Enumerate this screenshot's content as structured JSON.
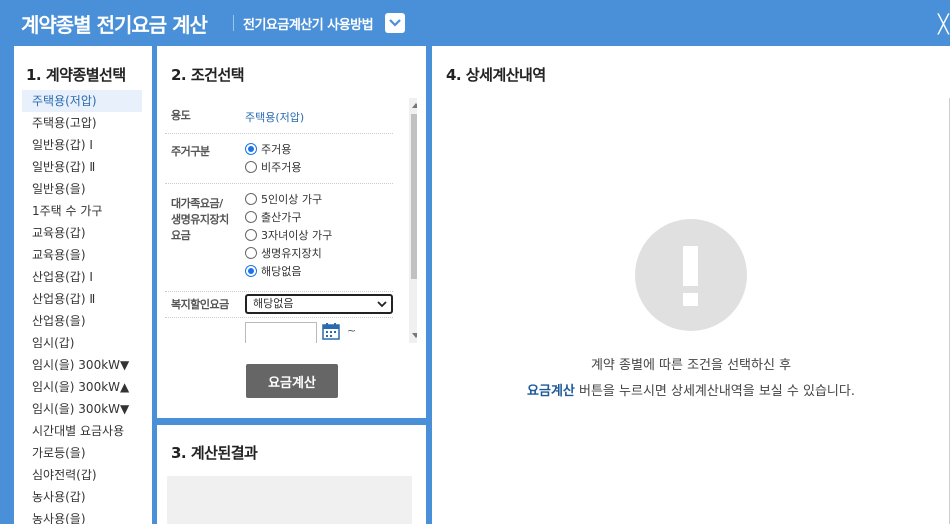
{
  "header": {
    "title": "계약종별 전기요금 계산",
    "howto_label": "전기요금계산기 사용방법"
  },
  "panel1": {
    "title": "1. 계약종별선택",
    "items": [
      "주택용(저압)",
      "주택용(고압)",
      "일반용(갑) Ⅰ",
      "일반용(갑) Ⅱ",
      "일반용(을)",
      "1주택 수 가구",
      "교육용(갑)",
      "교육용(을)",
      "산업용(갑) Ⅰ",
      "산업용(갑) Ⅱ",
      "산업용(을)",
      "임시(갑)",
      "임시(을) 300kW▼",
      "임시(을) 300kW▲",
      "임시(을) 300kW▼",
      "시간대별 요금사용",
      "가로등(을)",
      "심야전력(갑)",
      "농사용(갑)",
      "농사용(을)"
    ],
    "selected_index": 0
  },
  "panel2": {
    "title": "2. 조건선택",
    "usage_label": "용도",
    "usage_value": "주택용(저압)",
    "residence_label": "주거구분",
    "residence_options": [
      "주거용",
      "비주거용"
    ],
    "residence_selected": 0,
    "family_label_1": "대가족요금/",
    "family_label_2": "생명유지장치",
    "family_label_3": "요금",
    "family_options": [
      "5인이상 가구",
      "출산가구",
      "3자녀이상 가구",
      "생명유지장치",
      "해당없음"
    ],
    "family_selected": 4,
    "welfare_label": "복지할인요금",
    "welfare_value": "해당없음",
    "date_tilde": "~",
    "calc_button": "요금계산"
  },
  "panel3": {
    "title": "3. 계산된결과"
  },
  "panel4": {
    "title": "4. 상세계산내역",
    "message_line1": "계약 종별에 따른 조건을 선택하신 후",
    "message_highlight": "요금계산",
    "message_line2_rest": " 버튼을 누르시면 상세계산내역을 보실 수 있습니다."
  },
  "colors": {
    "header_bg": "#4a90d9",
    "accent": "#1e5a99",
    "button_bg": "#666666"
  }
}
